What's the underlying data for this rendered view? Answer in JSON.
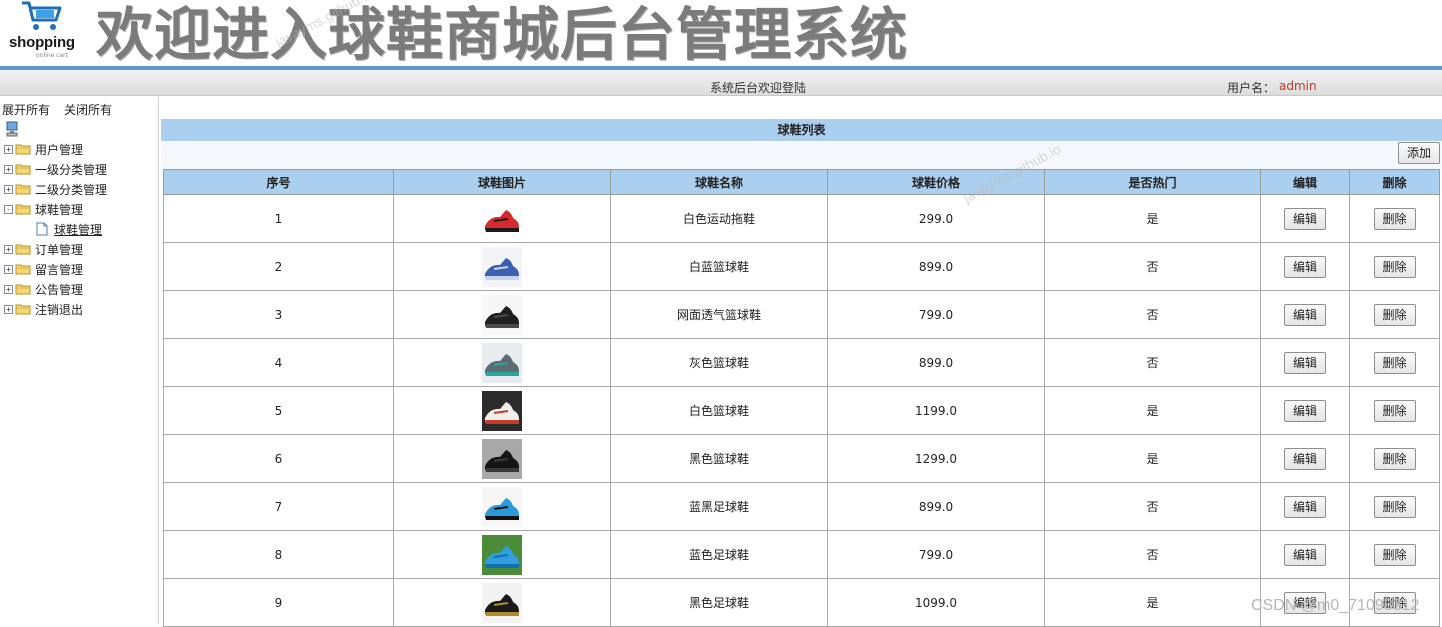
{
  "header": {
    "logo_text": "shopping",
    "logo_sub": "online cart",
    "title": "欢迎进入球鞋商城后台管理系统",
    "welcome": "系统后台欢迎登陆",
    "user_label": "用户名：",
    "user_name": "admin"
  },
  "sidebar": {
    "expand_all": "展开所有",
    "collapse_all": "关闭所有",
    "items": [
      {
        "label": "用户管理",
        "toggle": "+"
      },
      {
        "label": "一级分类管理",
        "toggle": "+"
      },
      {
        "label": "二级分类管理",
        "toggle": "+"
      },
      {
        "label": "球鞋管理",
        "toggle": "-"
      },
      {
        "label": "订单管理",
        "toggle": "+"
      },
      {
        "label": "留言管理",
        "toggle": "+"
      },
      {
        "label": "公告管理",
        "toggle": "+"
      },
      {
        "label": "注销退出",
        "toggle": "+"
      }
    ],
    "child": {
      "label": "球鞋管理"
    }
  },
  "main": {
    "list_title": "球鞋列表",
    "add_label": "添加",
    "columns": [
      "序号",
      "球鞋图片",
      "球鞋名称",
      "球鞋价格",
      "是否热门",
      "编辑",
      "删除"
    ],
    "edit_label": "编辑",
    "delete_label": "删除",
    "rows": [
      {
        "id": "1",
        "name": "白色运动拖鞋",
        "price": "299.0",
        "hot": "是",
        "img": "red-white-slide-icon",
        "colors": [
          "#ffffff",
          "#d8292f",
          "#1a1a1a"
        ]
      },
      {
        "id": "2",
        "name": "白蓝篮球鞋",
        "price": "899.0",
        "hot": "否",
        "img": "white-blue-sneaker-icon",
        "colors": [
          "#f4f4f8",
          "#3b5fb3",
          "#c9d4ee"
        ]
      },
      {
        "id": "3",
        "name": "网面透气篮球鞋",
        "price": "799.0",
        "hot": "否",
        "img": "black-mesh-sneaker-icon",
        "colors": [
          "#f7f7f7",
          "#1f1f1f",
          "#4a4a4a"
        ]
      },
      {
        "id": "4",
        "name": "灰色篮球鞋",
        "price": "899.0",
        "hot": "否",
        "img": "gray-sneaker-icon",
        "colors": [
          "#e8ecee",
          "#5d6b73",
          "#2aa69a"
        ]
      },
      {
        "id": "5",
        "name": "白色篮球鞋",
        "price": "1199.0",
        "hot": "是",
        "img": "white-highcut-sneaker-icon",
        "colors": [
          "#2b2b2b",
          "#f0eeea",
          "#c43b2b"
        ]
      },
      {
        "id": "6",
        "name": "黑色篮球鞋",
        "price": "1299.0",
        "hot": "是",
        "img": "black-basketball-sneaker-icon",
        "colors": [
          "#a8a8a8",
          "#151515",
          "#3a3a3a"
        ]
      },
      {
        "id": "7",
        "name": "蓝黑足球鞋",
        "price": "899.0",
        "hot": "否",
        "img": "blue-black-soccer-cleat-icon",
        "colors": [
          "#f6f6f6",
          "#2a9ad8",
          "#111111"
        ]
      },
      {
        "id": "8",
        "name": "蓝色足球鞋",
        "price": "799.0",
        "hot": "否",
        "img": "blue-soccer-cleat-icon",
        "colors": [
          "#4a8c3a",
          "#2f9fe0",
          "#0f6fb0"
        ]
      },
      {
        "id": "9",
        "name": "黑色足球鞋",
        "price": "1099.0",
        "hot": "是",
        "img": "black-gold-soccer-cleat-icon",
        "colors": [
          "#f3f3f3",
          "#1a1a1a",
          "#b08c2a"
        ]
      }
    ]
  },
  "watermarks": [
    "javayms.github.io",
    "javayms.github.io",
    "CSDN @m0_71098312"
  ]
}
